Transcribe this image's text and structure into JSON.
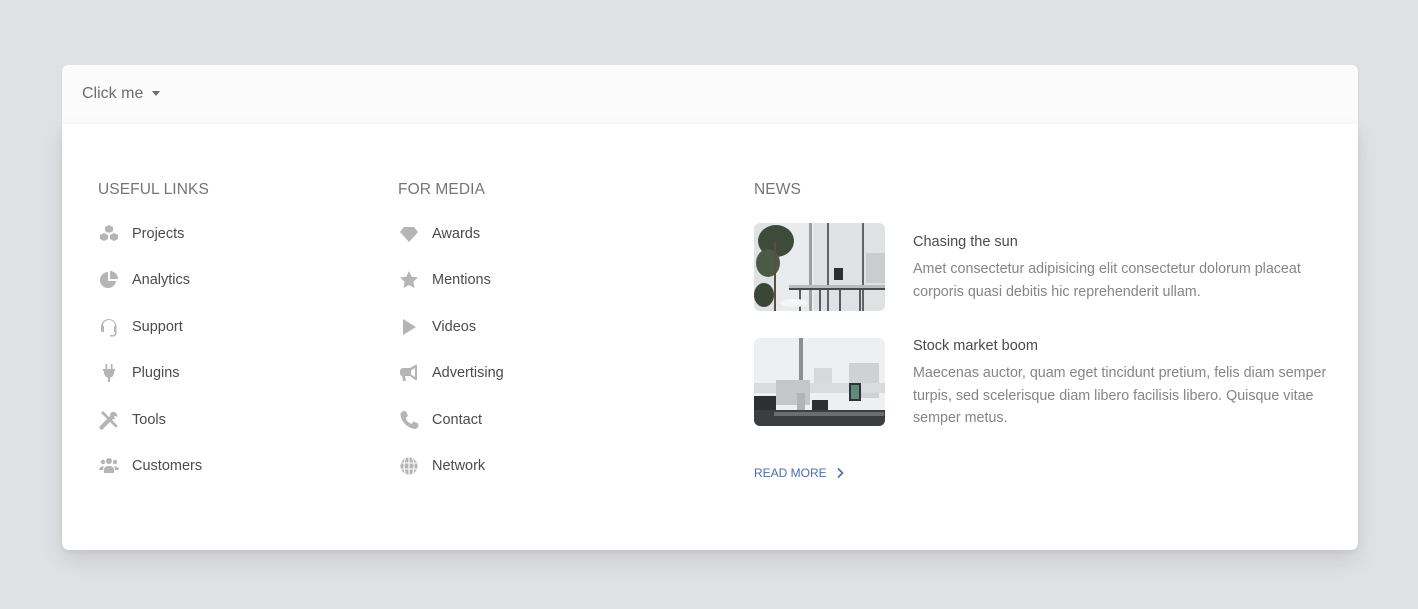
{
  "navbar": {
    "toggle_label": "Click me",
    "caret_icon": "caret-down-icon"
  },
  "menu": {
    "useful_links": {
      "title": "USEFUL LINKS",
      "items": [
        {
          "label": "Projects",
          "icon": "cubes-icon"
        },
        {
          "label": "Analytics",
          "icon": "chart-pie-icon"
        },
        {
          "label": "Support",
          "icon": "headset-icon"
        },
        {
          "label": "Plugins",
          "icon": "plug-icon"
        },
        {
          "label": "Tools",
          "icon": "tools-icon"
        },
        {
          "label": "Customers",
          "icon": "users-icon"
        }
      ]
    },
    "for_media": {
      "title": "FOR MEDIA",
      "items": [
        {
          "label": "Awards",
          "icon": "gem-icon"
        },
        {
          "label": "Mentions",
          "icon": "star-icon"
        },
        {
          "label": "Videos",
          "icon": "play-icon"
        },
        {
          "label": "Advertising",
          "icon": "bullhorn-icon"
        },
        {
          "label": "Contact",
          "icon": "phone-icon"
        },
        {
          "label": "Network",
          "icon": "globe-icon"
        }
      ]
    },
    "news": {
      "title": "NEWS",
      "items": [
        {
          "title": "Chasing the sun",
          "description": "Amet consectetur adipisicing elit consectetur dolorum placeat corporis quasi debitis hic reprehenderit ullam.",
          "image": "office-balcony-plants-photo"
        },
        {
          "title": "Stock market boom",
          "description": "Maecenas auctor, quam eget tincidunt pretium, felis diam semper turpis, sed scelerisque diam libero facilisis libero. Quisque vitae semper metus.",
          "image": "office-desk-computer-photo"
        }
      ],
      "read_more_label": "READ MORE",
      "read_more_icon": "chevron-right-icon"
    }
  },
  "colors": {
    "background": "#e0e1e4",
    "link_accent": "#4a6cb3",
    "icon_gray": "#b5b5b5"
  }
}
